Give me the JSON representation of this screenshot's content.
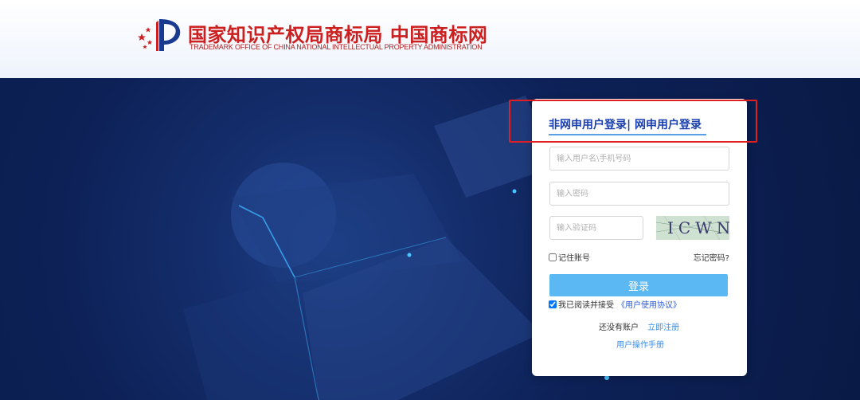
{
  "header": {
    "title_cn": "国家知识产权局商标局 中国商标网",
    "title_en": "TRADEMARK OFFICE OF CHINA NATIONAL INTELLECTUAL PROPERTY ADMINISTRATION",
    "logo_icon": "trademark-office-emblem",
    "brand_color": "#cc1f1f"
  },
  "login": {
    "tab_non_online": "非网申用户登录",
    "tab_separator": "|",
    "tab_online": "网申用户登录",
    "username_placeholder": "输入用户名\\手机号码",
    "password_placeholder": "输入密码",
    "captcha_placeholder": "输入验证码",
    "captcha_text": "ICWN",
    "remember_label": "记住账号",
    "remember_checked": false,
    "forgot_label": "忘记密码?",
    "login_button": "登录",
    "agree_label": "我已阅读并接受",
    "agree_checked": true,
    "agreement_link": "《用户使用协议》",
    "no_account_label": "还没有账户",
    "register_link": "立即注册",
    "manual_link": "用户操作手册",
    "accent_color": "#5cb8f2",
    "tab_color": "#1a3fb0"
  }
}
